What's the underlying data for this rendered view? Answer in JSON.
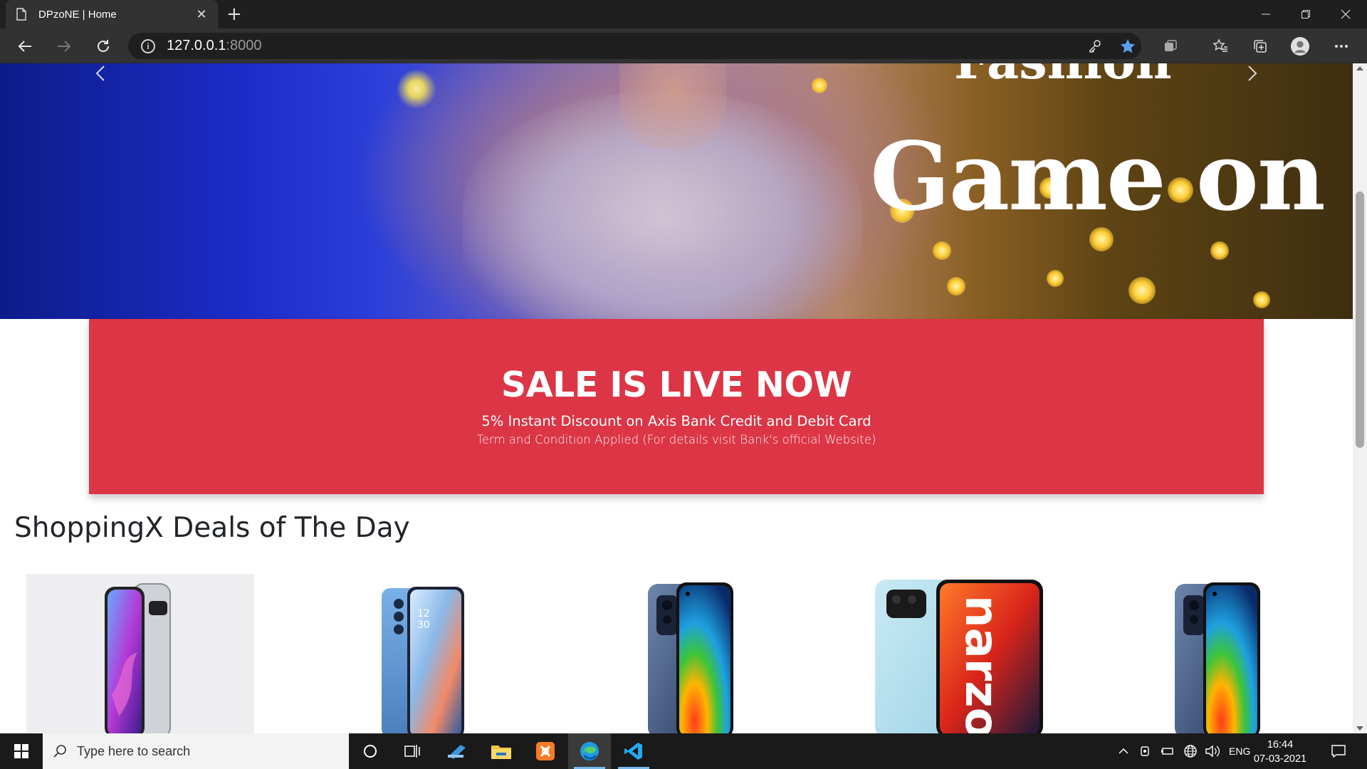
{
  "browser": {
    "tab_title": "DPzoNE | Home",
    "new_tab_label": "+",
    "address_host": "127.0.0.1",
    "address_port": ":8000"
  },
  "hero": {
    "headline_top": "Fashion",
    "headline": "Game on"
  },
  "sale_banner": {
    "title": "SALE IS LIVE NOW",
    "line1": "5% Instant Discount on Axis Bank Credit and Debit Card",
    "line2": "Term and Condition Applied (For details visit Bank's official Website)",
    "color": "#dc3545"
  },
  "deals": {
    "title": "ShoppingX Deals of The Day",
    "products": [
      {
        "name": "samsung-galaxy-phone"
      },
      {
        "name": "oppo-reno-phone"
      },
      {
        "name": "redmi-note-phone"
      },
      {
        "name": "realme-narzo-phone"
      },
      {
        "name": "redmi-note-phone-2"
      }
    ]
  },
  "taskbar": {
    "search_placeholder": "Type here to search",
    "language": "ENG",
    "time": "16:44",
    "date": "07-03-2021"
  }
}
